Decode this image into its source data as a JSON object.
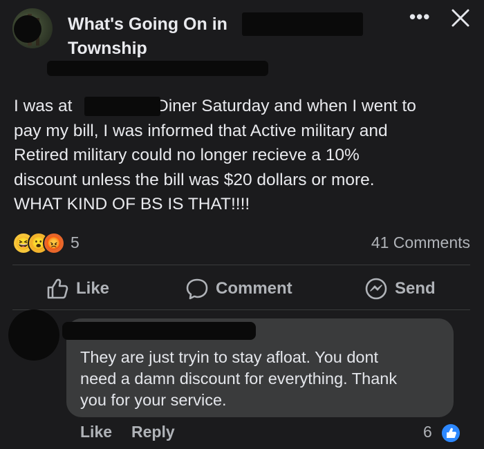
{
  "header": {
    "group_name": "What's Going On in Township",
    "more_label": "•••"
  },
  "post": {
    "text": "I was at Diner Saturday and when I went to pay my bill, I was informed that Active military and Retired military could no longer  recieve a 10% discount unless the bill was $20 dollars or more. WHAT KIND OF BS IS THAT!!!!",
    "line1_a": "I was at ",
    "line1_b": " Diner Saturday and when I went to",
    "line2": "pay my bill, I was informed that Active military and",
    "line3": "Retired military could no longer  recieve a 10%",
    "line4": "discount unless the bill was $20 dollars or more.",
    "line5": "WHAT KIND OF BS IS THAT!!!!",
    "reactions": {
      "icons": [
        "laughing-face",
        "wow-face",
        "angry-face"
      ],
      "count": "5"
    },
    "comments_count": "41 Comments"
  },
  "actions": {
    "like": "Like",
    "comment": "Comment",
    "send": "Send"
  },
  "comment": {
    "line1": "They are just tryin to stay afloat. You dont",
    "line2": "need a damn discount for everything. Thank",
    "line3": "you for your service.",
    "like_label": "Like",
    "reply_label": "Reply",
    "like_count": "6"
  },
  "colors": {
    "background": "#1b1b1d",
    "bubble": "#3a3b3c",
    "secondary_text": "#b0b3b8",
    "like_blue": "#2d88ff"
  }
}
